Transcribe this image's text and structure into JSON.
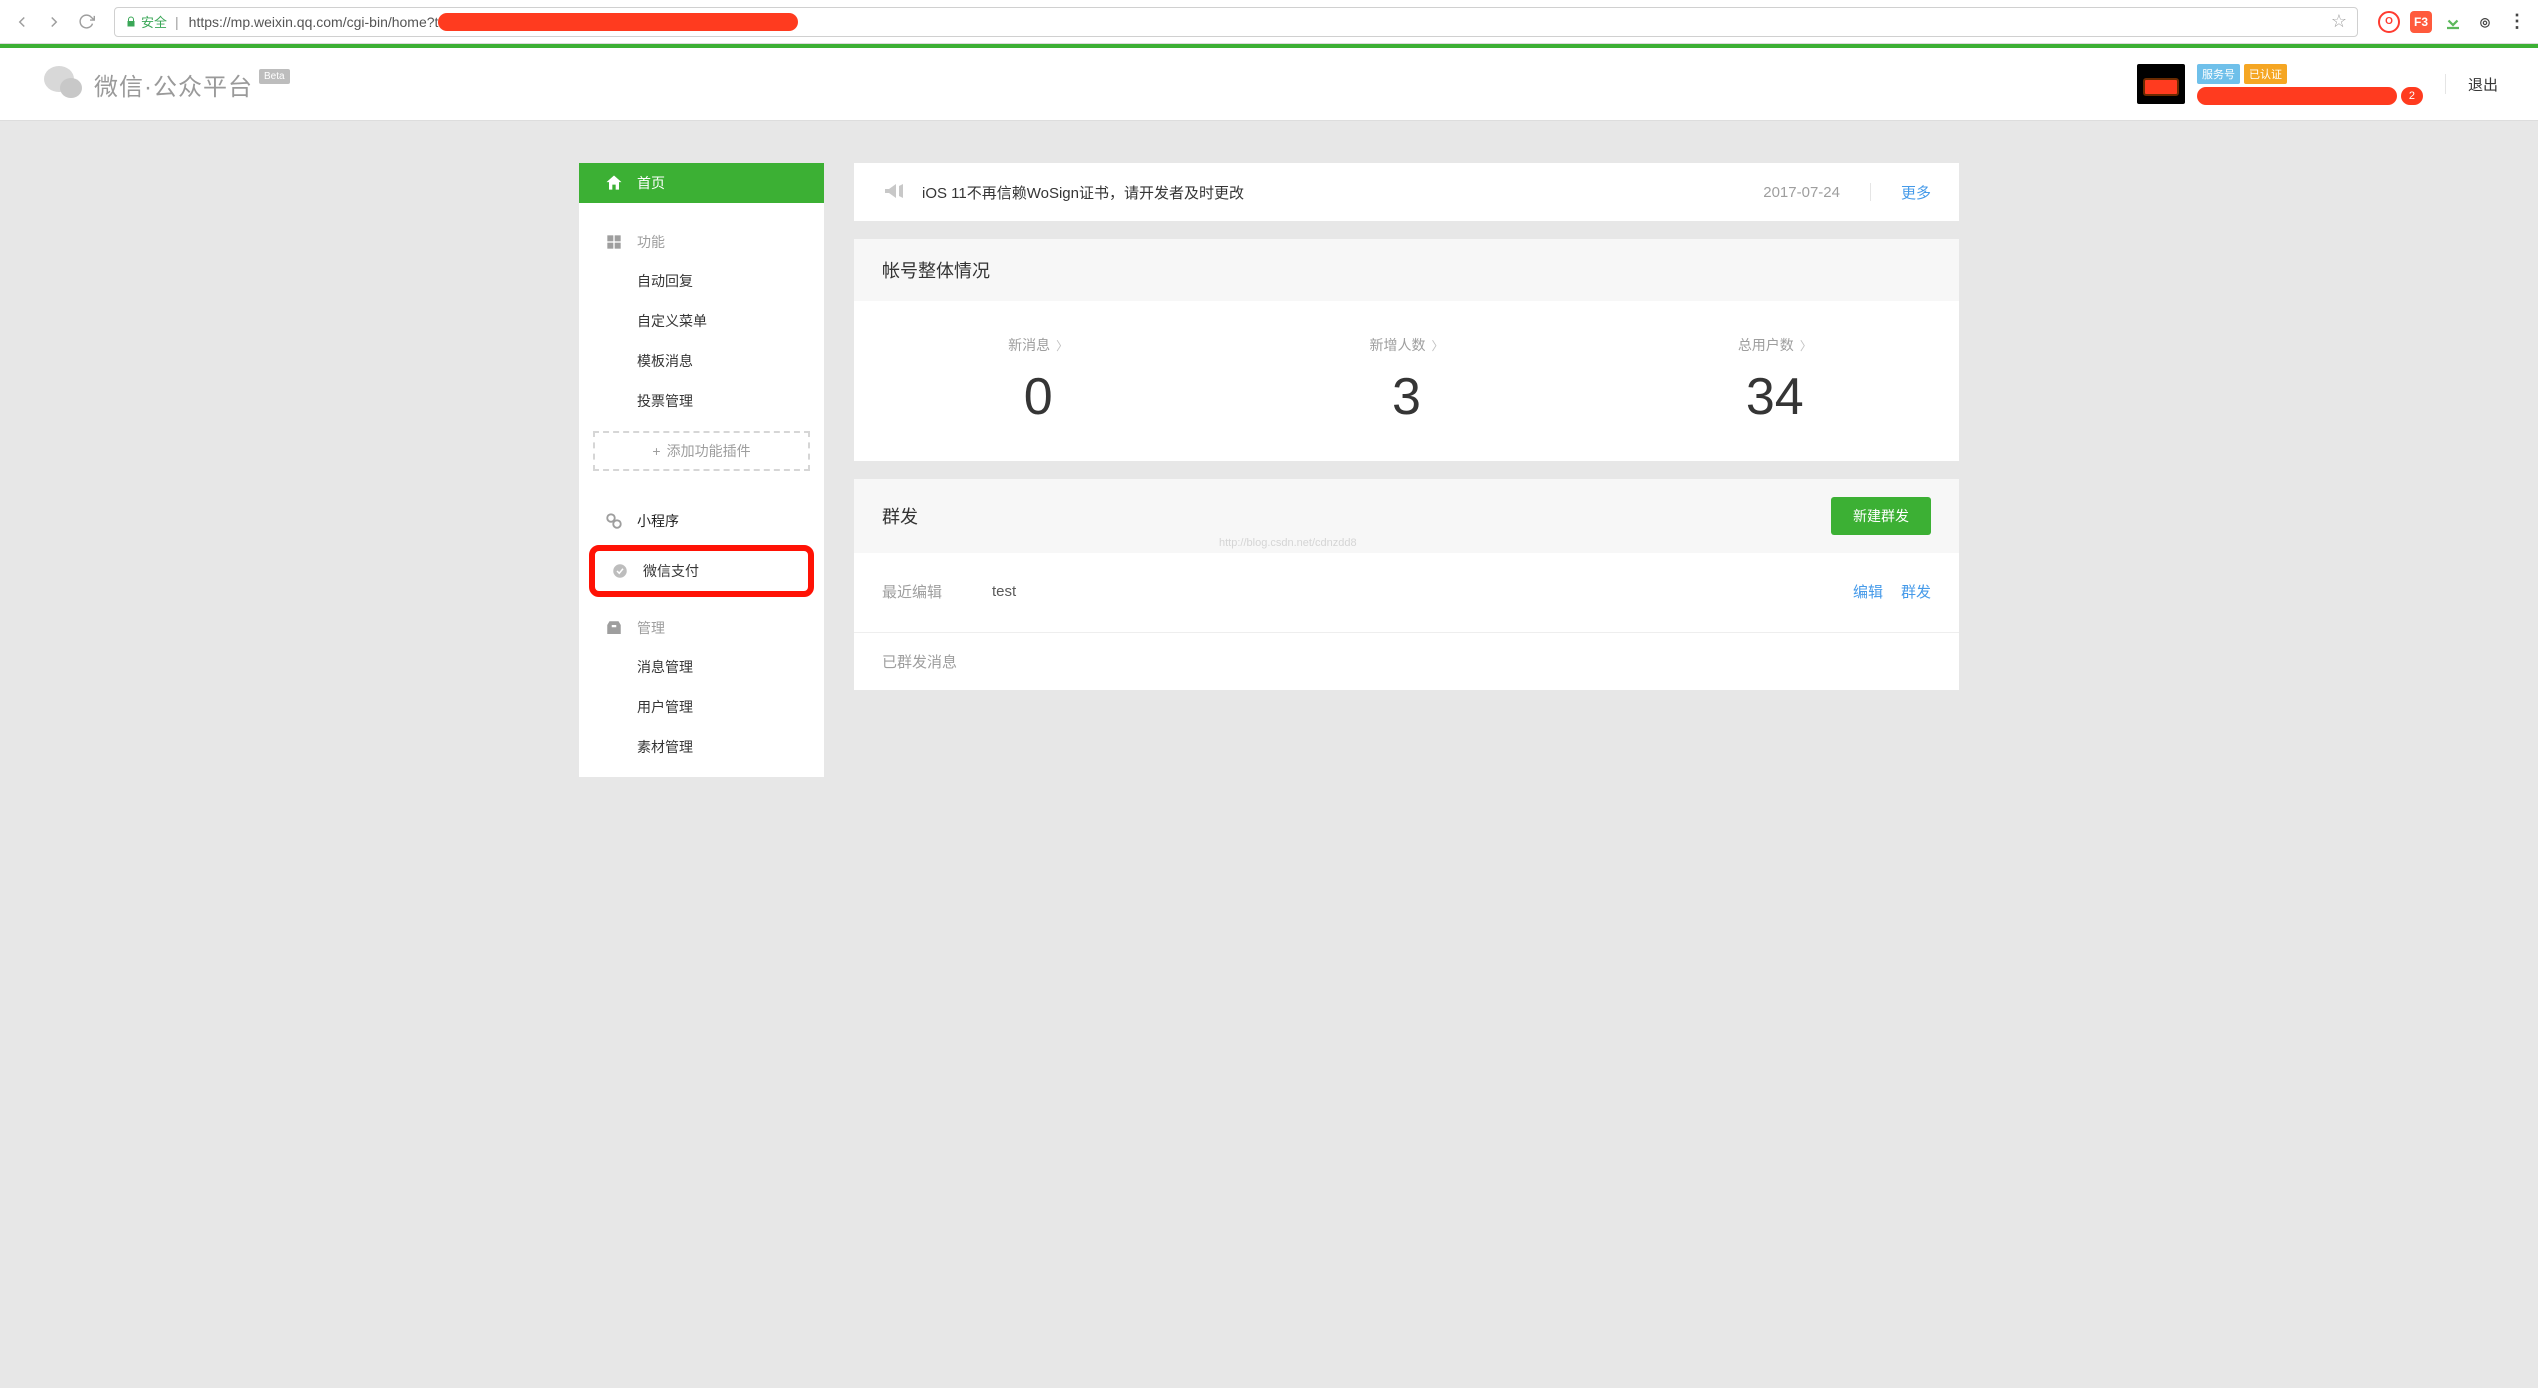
{
  "browser": {
    "secure_label": "安全",
    "url": "https://mp.weixin.qq.com/cgi-bin/home?t"
  },
  "header": {
    "product_name": "微信·公众平台",
    "badge": "Beta",
    "tag_service": "服务号",
    "tag_certified": "已认证",
    "notification_count": "2",
    "logout": "退出"
  },
  "sidebar": {
    "home": "首页",
    "cat_function": "功能",
    "func_auto_reply": "自动回复",
    "func_custom_menu": "自定义菜单",
    "func_template_msg": "模板消息",
    "func_vote_mgmt": "投票管理",
    "add_plugin": "添加功能插件",
    "miniapp": "小程序",
    "wxpay": "微信支付",
    "cat_manage": "管理",
    "mgmt_msg": "消息管理",
    "mgmt_user": "用户管理",
    "mgmt_material": "素材管理"
  },
  "announce": {
    "text": "iOS 11不再信赖WoSign证书，请开发者及时更改",
    "date": "2017-07-24",
    "more": "更多"
  },
  "stats": {
    "title": "帐号整体情况",
    "new_msg_label": "新消息",
    "new_msg_value": "0",
    "new_users_label": "新增人数",
    "new_users_value": "3",
    "total_users_label": "总用户数",
    "total_users_value": "34"
  },
  "broadcast": {
    "title": "群发",
    "new_button": "新建群发",
    "recent_label": "最近编辑",
    "recent_value": "test",
    "edit_action": "编辑",
    "send_action": "群发",
    "sent_label": "已群发消息"
  },
  "watermark": "http://blog.csdn.net/cdnzdd8"
}
